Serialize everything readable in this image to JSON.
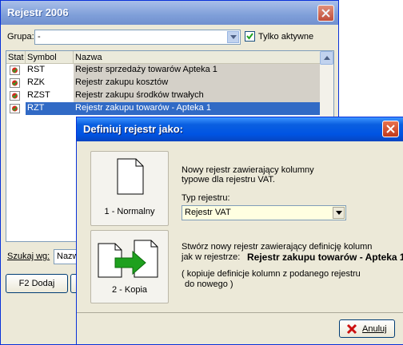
{
  "main": {
    "title": "Rejestr 2006",
    "group_label": "Grupa:",
    "group_value": "-",
    "only_active_label": "Tylko aktywne",
    "columns": [
      "Stat",
      "Symbol",
      "Nazwa"
    ],
    "rows": [
      {
        "symbol": "RST",
        "name": "Rejestr sprzedaży towarów Apteka 1"
      },
      {
        "symbol": "RZK",
        "name": "Rejestr zakupu kosztów"
      },
      {
        "symbol": "RZST",
        "name": "Rejestr zakupu środków trwałych"
      },
      {
        "symbol": "RZT",
        "name": "Rejestr zakupu towarów - Apteka 1"
      }
    ],
    "search_label": "Szukaj wg:",
    "search_value": "Nazw",
    "add_button": "F2 Dodaj"
  },
  "dialog": {
    "title": "Definiuj rejestr jako:",
    "normal_button": "1 - Normalny",
    "normal_desc_line1": "Nowy rejestr zawierający kolumny",
    "normal_desc_line2": "typowe dla rejestru VAT.",
    "type_label": "Typ rejestru:",
    "type_value": "Rejestr VAT",
    "copy_button": "2 - Kopia",
    "copy_desc_line1": "Stwórz nowy rejestr zawierający definicję kolumn",
    "copy_desc_line2": "jak w rejestrze:",
    "copy_source": "Rejestr zakupu towarów - Apteka 1",
    "copy_note_line1": "( kopiuje definicje kolumn z podanego rejestru",
    "copy_note_line2": "do nowego )",
    "cancel_button": "Anuluj"
  },
  "icons": {
    "close": "close-icon",
    "dropdown": "chevron-down-icon",
    "checkbox": "checkmark-icon",
    "status": "status-icon",
    "document": "document-icon",
    "copy": "copy-documents-icon",
    "cancel": "red-x-icon"
  },
  "colors": {
    "selection": "#316ac5",
    "dialog_title": "#0054e3",
    "window_bg": "#ece9d8",
    "arrow": "#1ea01e"
  }
}
